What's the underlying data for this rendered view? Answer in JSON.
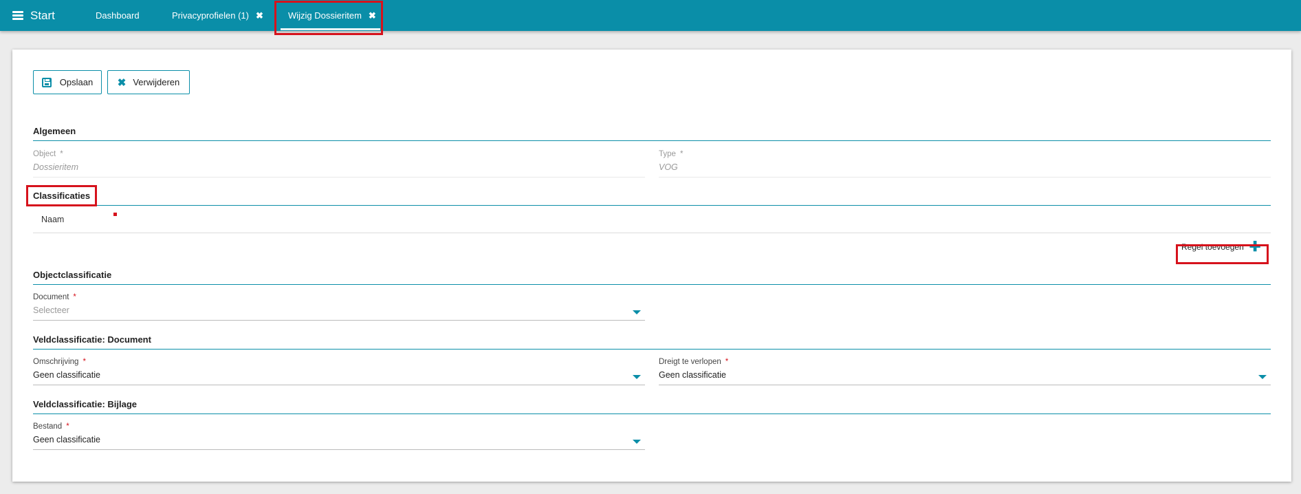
{
  "topbar": {
    "start_label": "Start",
    "tabs": [
      {
        "label": "Dashboard",
        "closable": false
      },
      {
        "label": "Privacyprofielen (1)",
        "closable": true
      },
      {
        "label": "Wijzig Dossieritem",
        "closable": true,
        "active": true
      }
    ],
    "close_glyph": "✖"
  },
  "toolbar": {
    "save_label": "Opslaan",
    "delete_label": "Verwijderen",
    "delete_glyph": "✖"
  },
  "sections": {
    "algemeen": "Algemeen",
    "classificaties": "Classificaties",
    "objectclassificatie": "Objectclassificatie",
    "veld_document": "Veldclassificatie: Document",
    "veld_bijlage": "Veldclassificatie: Bijlage"
  },
  "algemeen": {
    "object_label": "Object",
    "object_value": "Dossieritem",
    "type_label": "Type",
    "type_value": "VOG"
  },
  "classificaties": {
    "column_naam": "Naam",
    "add_row_label": "Regel toevoegen",
    "add_glyph": "✚"
  },
  "objectclassificatie": {
    "document_label": "Document",
    "document_placeholder": "Selecteer"
  },
  "veld_document": {
    "omschrijving_label": "Omschrijving",
    "omschrijving_value": "Geen classificatie",
    "dreigt_label": "Dreigt te verlopen",
    "dreigt_value": "Geen classificatie"
  },
  "veld_bijlage": {
    "bestand_label": "Bestand",
    "bestand_value": "Geen classificatie"
  },
  "required_marker": "*",
  "colors": {
    "accent": "#0a8ea8",
    "highlight": "#d6121c",
    "background": "#ececec"
  },
  "icons": {
    "menu": "hamburger-icon",
    "save": "floppy-disk-icon",
    "delete": "close-icon",
    "tab_close": "close-icon",
    "dropdown": "chevron-down-icon",
    "add": "plus-icon"
  }
}
